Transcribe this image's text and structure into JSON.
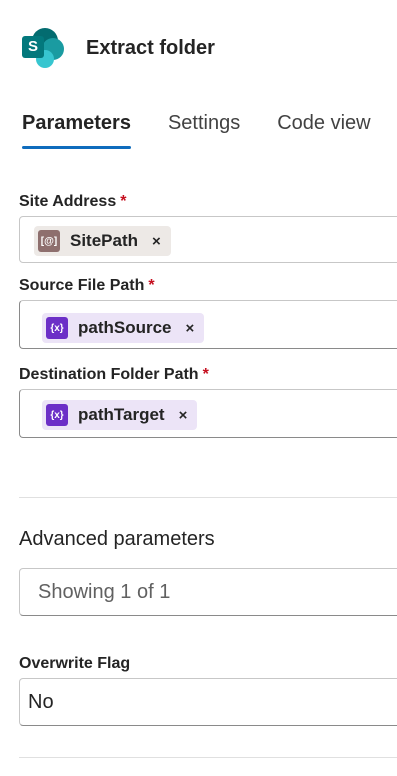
{
  "header": {
    "app_icon": "sharepoint-icon",
    "app_icon_letter": "S",
    "title": "Extract folder"
  },
  "tabs": [
    {
      "label": "Parameters",
      "active": true
    },
    {
      "label": "Settings",
      "active": false
    },
    {
      "label": "Code view",
      "active": false
    }
  ],
  "fields": {
    "site_address": {
      "label": "Site Address",
      "required_mark": "*",
      "token": {
        "label": "SitePath",
        "icon": "parameter-icon",
        "icon_glyph": "[@]",
        "remove": "×"
      }
    },
    "source_file_path": {
      "label": "Source File Path",
      "required_mark": "*",
      "token": {
        "label": "pathSource",
        "icon": "variable-icon",
        "icon_glyph": "{x}",
        "remove": "×"
      }
    },
    "destination_folder_path": {
      "label": "Destination Folder Path",
      "required_mark": "*",
      "token": {
        "label": "pathTarget",
        "icon": "variable-icon",
        "icon_glyph": "{x}",
        "remove": "×"
      }
    }
  },
  "advanced": {
    "title": "Advanced parameters",
    "dropdown_value": "Showing 1 of 1"
  },
  "overwrite_flag": {
    "label": "Overwrite Flag",
    "value": "No"
  },
  "colors": {
    "accent": "#0f6cbd",
    "required": "#c50f1f",
    "variable_token_bg": "#ece4f7",
    "variable_icon": "#6c2fc7",
    "parameter_token_bg": "#ede9e6",
    "parameter_icon": "#8e6f6e"
  }
}
